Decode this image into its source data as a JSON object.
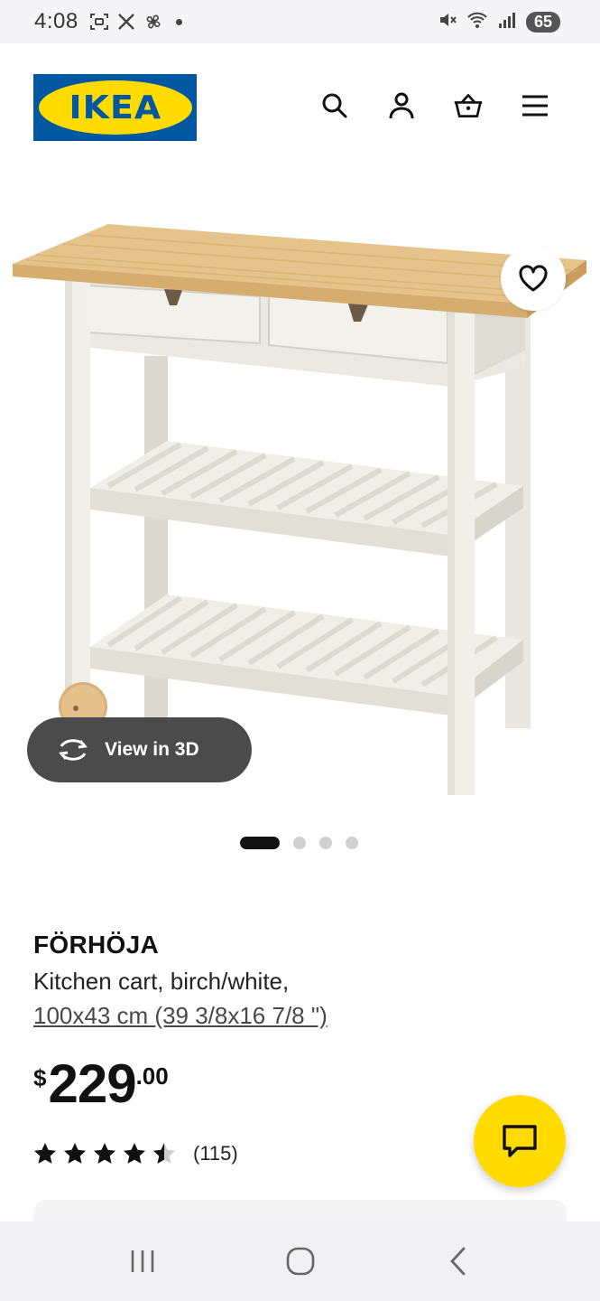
{
  "status_bar": {
    "time": "4:08",
    "battery": "65",
    "icons_left": [
      "screenshot-icon",
      "x-icon",
      "fan-icon"
    ],
    "icons_right": [
      "mute-icon",
      "wifi-icon",
      "signal-icon"
    ]
  },
  "header": {
    "logo_text": "IKEA",
    "icons": [
      "search-icon",
      "account-icon",
      "cart-icon",
      "menu-icon"
    ]
  },
  "gallery": {
    "view_3d_label": "View in 3D",
    "page_count": 4,
    "active_page": 1
  },
  "product": {
    "name": "FÖRHÖJA",
    "description": "Kitchen cart, birch/white,",
    "measurements": "100x43 cm (39 3/8x16 7/8 \")",
    "price_currency": "$",
    "price_int": "229",
    "price_dec": ".00",
    "rating": 4.5,
    "rating_count": "(115)"
  },
  "colors": {
    "brand_blue": "#0058a3",
    "brand_yellow": "#ffdb00",
    "view3d_bg": "#4b4b4b"
  },
  "nav_bar": {
    "buttons": [
      "recents-icon",
      "home-icon",
      "back-icon"
    ]
  }
}
